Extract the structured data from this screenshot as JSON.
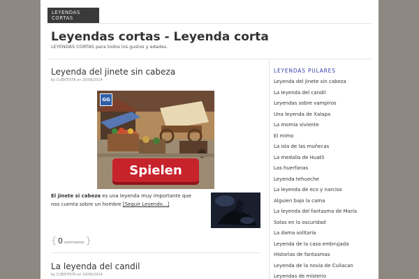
{
  "nav": {
    "label": "LEYENDAS CORTAS"
  },
  "header": {
    "title": "Leyendas cortas - Leyenda corta",
    "tagline": "LEYENDAS CORTAS para todos los gustos y edades."
  },
  "posts": [
    {
      "title": "Leyenda del jinete sin cabeza",
      "meta": "by CUENTISTA on 20/06/2014",
      "excerpt_bold": "El jinete si cabeza",
      "excerpt_text": " es una leyenda muy importante que nos cuenta sobre un hombre ",
      "read_more": "[Seguir Leyendo...]",
      "comments_count": "0",
      "comments_label": "comments",
      "brace_open": "{",
      "brace_close": "}"
    },
    {
      "title": "La leyenda del candil",
      "meta": "by CUENTISTA on 19/06/2014"
    }
  ],
  "ad": {
    "button_label": "Spielen",
    "logo_text": "GG"
  },
  "sidebar": {
    "title": "LEYENDAS PULARES",
    "items": [
      "Leyenda del jinete sin cabeza",
      "La leyenda del candil",
      "Leyendas sobre vampiros",
      "Una leyenda de Xalapa",
      "La momia viviente",
      "El mimo",
      "La isla de las muñecas",
      "La medalla de Huatli",
      "Las huerfanas",
      "Leyenda tehueche",
      "La leyenda de eco y narciso",
      "Alguien bajo la cama",
      "La leyenda del fantasma de María",
      "Solas en la oscuridad",
      "La dama solitaria",
      "Leyenda de la casa embrujada",
      "Historias de fantasmas",
      "Leyenda de la novia de Culiacan",
      "Leyendas de misterio"
    ]
  }
}
